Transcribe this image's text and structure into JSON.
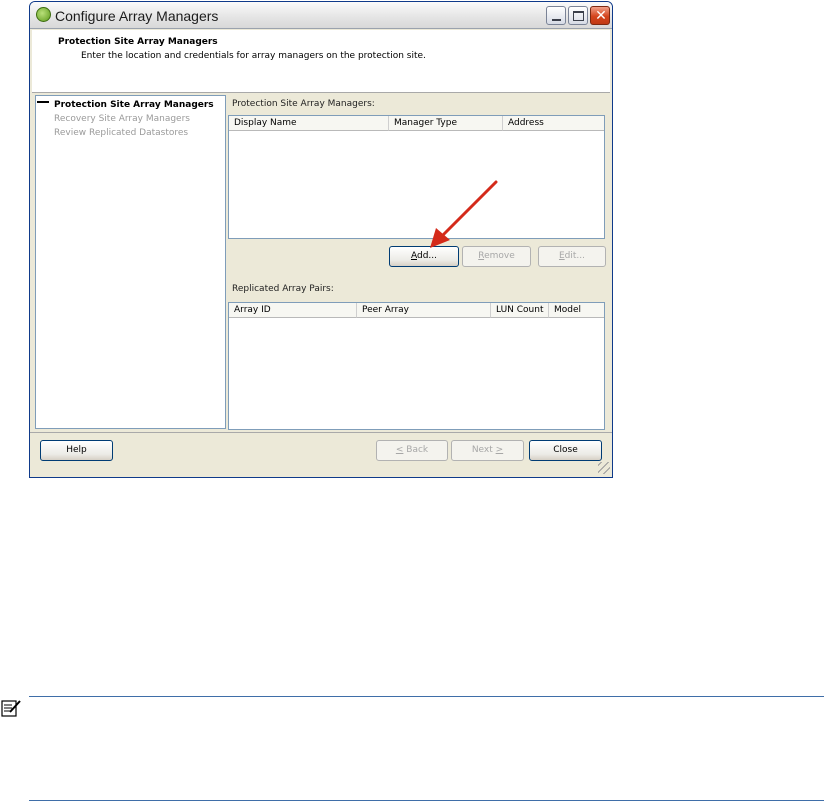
{
  "window": {
    "title": "Configure Array Managers"
  },
  "header": {
    "title": "Protection Site Array Managers",
    "subtitle": "Enter the location and credentials for array managers on the protection site."
  },
  "nav": {
    "items": [
      {
        "label": "Protection Site Array Managers",
        "active": true
      },
      {
        "label": "Recovery Site Array Managers",
        "active": false
      },
      {
        "label": "Review Replicated Datastores",
        "active": false
      }
    ]
  },
  "managers": {
    "label": "Protection Site Array Managers:",
    "columns": [
      "Display Name",
      "Manager Type",
      "Address"
    ],
    "rows": []
  },
  "buttons": {
    "add_prefix": "",
    "add_mnemonic": "A",
    "add_rest": "dd...",
    "remove_mnemonic": "R",
    "remove_rest": "emove",
    "edit_mnemonic": "E",
    "edit_rest": "dit..."
  },
  "pairs": {
    "label": "Replicated Array Pairs:",
    "columns": [
      "Array ID",
      "Peer Array",
      "LUN Count",
      "Model"
    ],
    "rows": []
  },
  "footer": {
    "help": "Help",
    "back_mnemonic": "<",
    "back_rest": " Back",
    "next_prefix": "Next ",
    "next_mnemonic": ">",
    "close": "Close"
  },
  "colors": {
    "arrow": "#d42a1a",
    "note_rule": "#3f6ea8"
  },
  "icons": [
    "app-icon",
    "minimize-icon",
    "maximize-icon",
    "close-icon",
    "arrow-icon",
    "note-icon",
    "resize-grip-icon"
  ]
}
